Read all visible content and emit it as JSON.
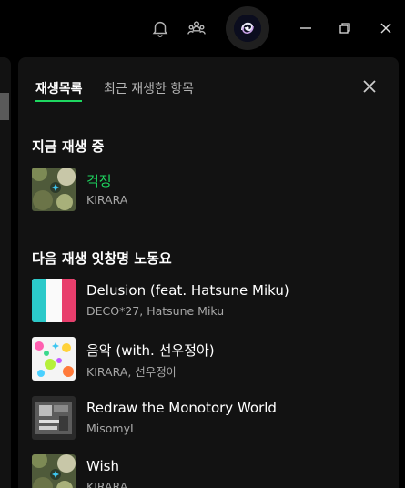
{
  "tabs": {
    "queue": "재생목록",
    "recent": "최근 재생한 항목"
  },
  "now_playing": {
    "heading": "지금 재생 중",
    "track": {
      "title": "걱정",
      "artist": "KIRARA"
    }
  },
  "next_up": {
    "heading": "다음 재생 잇창명 노동요",
    "tracks": [
      {
        "title": "Delusion (feat. Hatsune Miku)",
        "artist": "DECO*27, Hatsune Miku"
      },
      {
        "title": "음악 (with. 선우정아)",
        "artist": "KIRARA, 선우정아"
      },
      {
        "title": "Redraw the Monotory World",
        "artist": "MisomyL"
      },
      {
        "title": "Wish",
        "artist": "KIRARA"
      }
    ]
  },
  "colors": {
    "accent": "#1ed760",
    "panel_bg": "#121212",
    "app_bg": "#000000"
  },
  "icons": [
    "bell-icon",
    "friends-icon",
    "avatar",
    "minimize-icon",
    "restore-icon",
    "close-icon"
  ]
}
